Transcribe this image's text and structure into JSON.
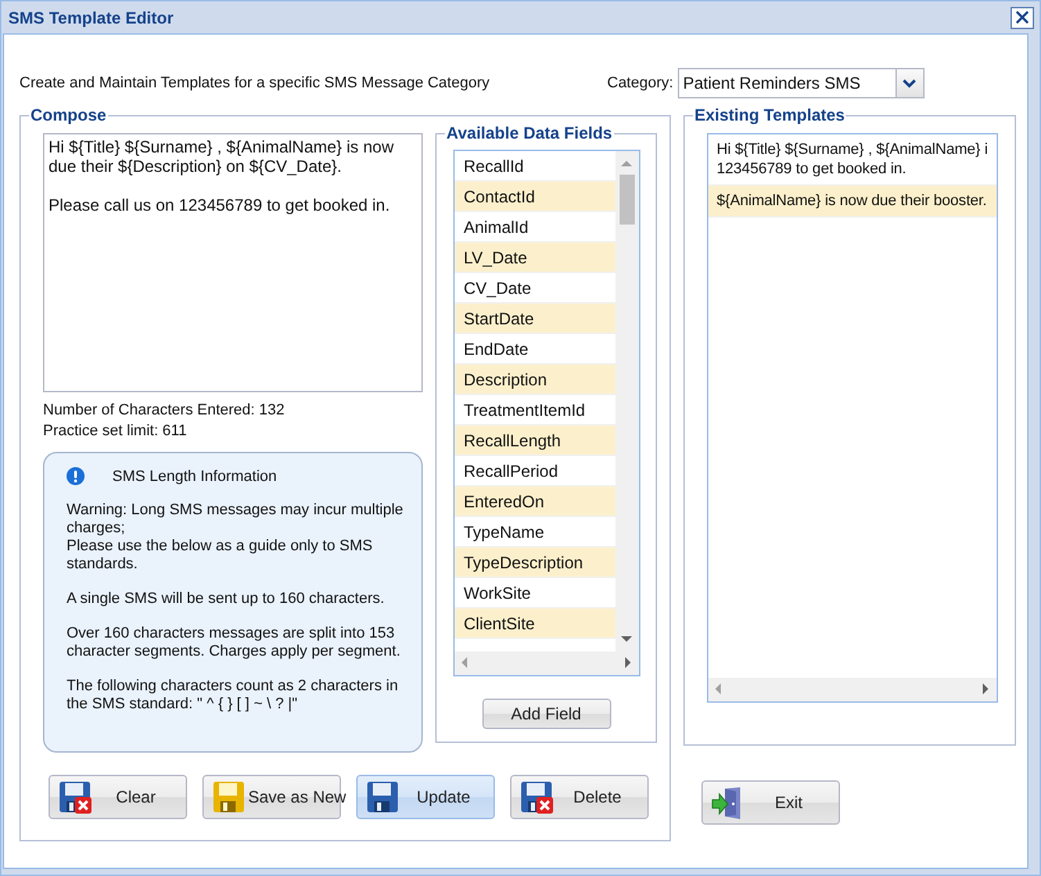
{
  "window": {
    "title": "SMS Template Editor"
  },
  "description": "Create and Maintain Templates for a specific SMS Message Category",
  "category": {
    "label": "Category:",
    "value": "Patient Reminders SMS"
  },
  "compose": {
    "legend": "Compose",
    "message": "Hi ${Title} ${Surname} , ${AnimalName} is now due their ${Description} on ${CV_Date}.\n\nPlease call us on 123456789 to get booked in.",
    "characters_entered": "Number of Characters Entered: 132",
    "practice_limit": "Practice set limit: 611",
    "info": {
      "title": "SMS Length Information",
      "paragraphs": [
        "Warning: Long SMS messages may incur multiple charges;\nPlease use the below as a guide only to SMS standards.",
        "A single SMS will be sent up to 160 characters.",
        "Over 160 characters messages are split into 153 character segments. Charges apply per segment.",
        "The following characters count as 2 characters in the SMS standard: \" ^ { } [ ] ~ \\ ? |\""
      ]
    }
  },
  "data_fields": {
    "legend": "Available Data Fields",
    "fields": [
      "RecallId",
      "ContactId",
      "AnimalId",
      "LV_Date",
      "CV_Date",
      "StartDate",
      "EndDate",
      "Description",
      "TreatmentItemId",
      "RecallLength",
      "RecallPeriod",
      "EnteredOn",
      "TypeName",
      "TypeDescription",
      "WorkSite",
      "ClientSite"
    ],
    "add_button": "Add Field"
  },
  "templates": {
    "legend": "Existing Templates",
    "rows": [
      {
        "lines": [
          "Hi ${Title} ${Surname} , ${AnimalName} i",
          "123456789 to get booked in."
        ]
      },
      {
        "lines": [
          "${AnimalName} is now due their booster."
        ]
      }
    ]
  },
  "buttons": [
    {
      "label": "Clear",
      "kind": "clear",
      "highlighted": false
    },
    {
      "label": "Save as New",
      "kind": "save",
      "highlighted": false
    },
    {
      "label": "Update",
      "kind": "update",
      "highlighted": true
    },
    {
      "label": "Delete",
      "kind": "delete",
      "highlighted": false
    }
  ],
  "exit": {
    "label": "Exit"
  }
}
